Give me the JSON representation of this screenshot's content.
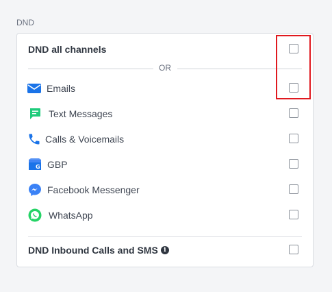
{
  "section": {
    "label": "DND"
  },
  "dnd_all": {
    "label": "DND all channels"
  },
  "separator": {
    "text": "OR"
  },
  "channels": [
    {
      "label": "Emails",
      "icon": "mail-icon"
    },
    {
      "label": "Text Messages",
      "icon": "sms-icon"
    },
    {
      "label": "Calls & Voicemails",
      "icon": "phone-icon"
    },
    {
      "label": "GBP",
      "icon": "google-business-icon"
    },
    {
      "label": "Facebook Messenger",
      "icon": "messenger-icon"
    },
    {
      "label": "WhatsApp",
      "icon": "whatsapp-icon"
    }
  ],
  "inbound": {
    "label": "DND Inbound Calls and SMS",
    "icon": "info-icon"
  },
  "colors": {
    "highlight": "#e0191f",
    "email": "#1a73e8",
    "sms": "#1ecb7b",
    "phone": "#1a73e8",
    "gbp": "#4285f4",
    "messenger": "#3b82f6",
    "whatsapp": "#25d366"
  }
}
